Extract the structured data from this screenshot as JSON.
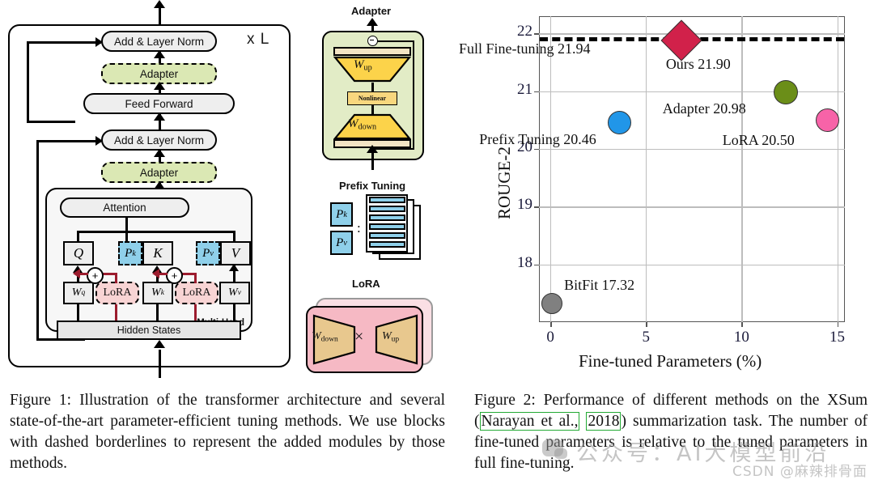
{
  "figure1": {
    "repeat_label": "x L",
    "blocks": [
      {
        "id": "add-norm-top",
        "label": "Add & Layer Norm"
      },
      {
        "id": "adapter-top",
        "label": "Adapter"
      },
      {
        "id": "feed-forward",
        "label": "Feed Forward"
      },
      {
        "id": "add-norm-bottom",
        "label": "Add & Layer Norm"
      },
      {
        "id": "adapter-bottom",
        "label": "Adapter"
      },
      {
        "id": "attention",
        "label": "Attention"
      },
      {
        "id": "hidden-states",
        "label": "Hidden States"
      }
    ],
    "multi_head_label": "Multi-Head",
    "qkv": [
      "Q",
      "K",
      "V"
    ],
    "prefix_tokens": [
      "P",
      "P"
    ],
    "prefix_token_subs": [
      "k",
      "v"
    ],
    "weights": [
      "W",
      "W",
      "W"
    ],
    "weight_subs": [
      "q",
      "k",
      "v"
    ],
    "lora_label": "LoRA",
    "adapter_module": {
      "title": "Adapter",
      "w_up": "W",
      "w_up_sub": "up",
      "w_down": "W",
      "w_down_sub": "down",
      "nonlinear": "Nonlinear"
    },
    "prefix_module": {
      "title": "Prefix Tuning",
      "pk": "P",
      "pk_sub": "k",
      "pv": "P",
      "pv_sub": "v",
      "separator": ":"
    },
    "lora_module": {
      "title": "LoRA",
      "w_down": "W",
      "w_down_sub": "down",
      "w_up": "W",
      "w_up_sub": "up",
      "operator": "×"
    }
  },
  "chart_data": {
    "type": "scatter",
    "title": "",
    "xlabel": "Fine-tuned Parameters (%)",
    "ylabel": "ROUGE-2",
    "xlim": [
      -0.6,
      15.4
    ],
    "ylim": [
      17.0,
      22.3
    ],
    "xticks": [
      0,
      5,
      10,
      15
    ],
    "xtick_labels": [
      "0",
      "5",
      "10",
      "15"
    ],
    "yticks": [
      18,
      19,
      20,
      21,
      22
    ],
    "ytick_labels": [
      "18",
      "19",
      "20",
      "21",
      "22"
    ],
    "grid": true,
    "legend": "none",
    "reference_line": {
      "label": "Full Fine-tuning 21.94",
      "value": 21.94,
      "style": "dashed",
      "color": "#000000"
    },
    "points": [
      {
        "name": "BitFit",
        "label": "BitFit 17.32",
        "x": 0.08,
        "y": 17.32,
        "color": "#808080",
        "marker": "circle",
        "size": 26
      },
      {
        "name": "Prefix Tuning",
        "label": "Prefix Tuning 20.46",
        "x": 3.6,
        "y": 20.46,
        "color": "#2196e8",
        "marker": "circle",
        "size": 29
      },
      {
        "name": "Adapter",
        "label": "Adapter 20.98",
        "x": 12.3,
        "y": 20.98,
        "color": "#6b8e18",
        "marker": "circle",
        "size": 30
      },
      {
        "name": "LoRA",
        "label": "LoRA 20.50",
        "x": 14.5,
        "y": 20.5,
        "color": "#f763a8",
        "marker": "circle",
        "size": 29
      },
      {
        "name": "Ours",
        "label": "Ours 21.90",
        "x": 6.8,
        "y": 21.9,
        "color": "#d1214a",
        "marker": "diamond",
        "size": 34
      }
    ]
  },
  "captions": {
    "fig1": "Figure 1: Illustration of the transformer architecture and several state-of-the-art parameter-efficient tuning methods.  We use blocks with dashed borderlines to represent the added modules by those methods.",
    "fig2_part1": "Figure 2: Performance of different methods on the XSum (",
    "fig2_link1": "Narayan et al.,",
    "fig2_link2": "2018",
    "fig2_part2": ") summarization task. The number of fine-tuned parameters is relative to the tuned parameters in full fine-tuning."
  },
  "watermark": {
    "cn_text": "公众号：AI大模型前沿",
    "csdn_text": "CSDN @麻辣排骨面"
  }
}
